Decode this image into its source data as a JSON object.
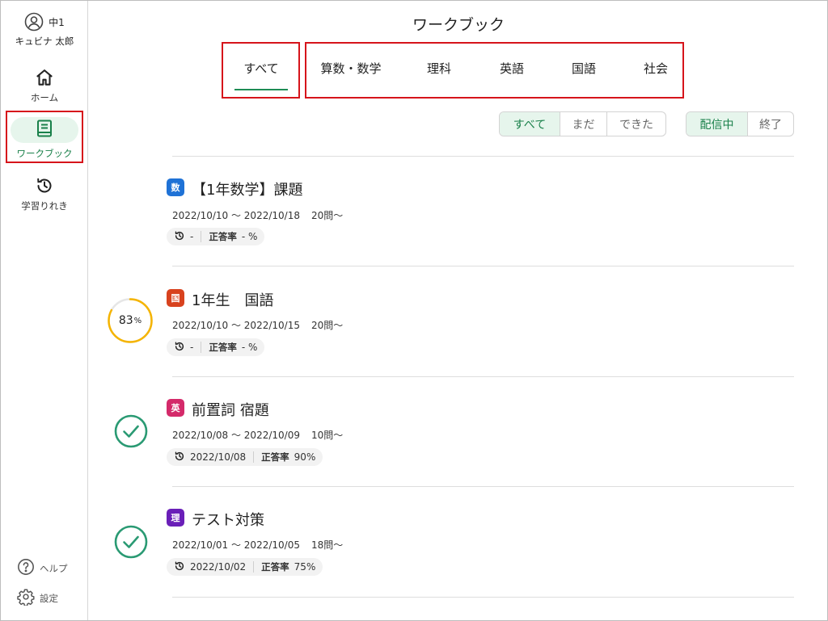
{
  "user": {
    "grade": "中1",
    "name": "キュビナ 太郎"
  },
  "nav": {
    "home": "ホーム",
    "workbook": "ワークブック",
    "history": "学習りれき",
    "help": "ヘルプ",
    "settings": "設定"
  },
  "page": {
    "title": "ワークブック"
  },
  "tabs": [
    {
      "label": "すべて",
      "selected": true
    },
    {
      "label": "算数・数学"
    },
    {
      "label": "理科"
    },
    {
      "label": "英語"
    },
    {
      "label": "国語"
    },
    {
      "label": "社会"
    }
  ],
  "filters": {
    "status": [
      {
        "label": "すべて",
        "active": true
      },
      {
        "label": "まだ"
      },
      {
        "label": "できた"
      }
    ],
    "delivery": [
      {
        "label": "配信中",
        "active": true
      },
      {
        "label": "終了"
      }
    ]
  },
  "colors": {
    "accent": "#19804a",
    "math": "#1f72d6",
    "japanese": "#d8421e",
    "english": "#d42a6a",
    "science": "#6a1fb8",
    "progress": "#f5b400",
    "check": "#2a9a73"
  },
  "workbooks": [
    {
      "badge": "数",
      "title": "【1年数学】課題",
      "period": "2022/10/10 ～ 2022/10/18",
      "questions": "20問～",
      "last_date": "-",
      "rate_label": "正答率",
      "rate": "- %",
      "progress_percent": null,
      "progress_text": "",
      "completed": false
    },
    {
      "badge": "国",
      "title": "1年生　国語",
      "period": "2022/10/10 ～ 2022/10/15",
      "questions": "20問～",
      "last_date": "-",
      "rate_label": "正答率",
      "rate": "- %",
      "progress_percent": 83,
      "progress_text": "83",
      "progress_unit": "%",
      "completed": false
    },
    {
      "badge": "英",
      "title": "前置詞 宿題",
      "period": "2022/10/08 ～ 2022/10/09",
      "questions": "10問～",
      "last_date": "2022/10/08",
      "rate_label": "正答率",
      "rate": "90%",
      "progress_percent": null,
      "progress_text": "",
      "completed": true
    },
    {
      "badge": "理",
      "title": "テスト対策",
      "period": "2022/10/01 ～ 2022/10/05",
      "questions": "18問～",
      "last_date": "2022/10/02",
      "rate_label": "正答率",
      "rate": "75%",
      "progress_percent": null,
      "progress_text": "",
      "completed": true
    }
  ]
}
